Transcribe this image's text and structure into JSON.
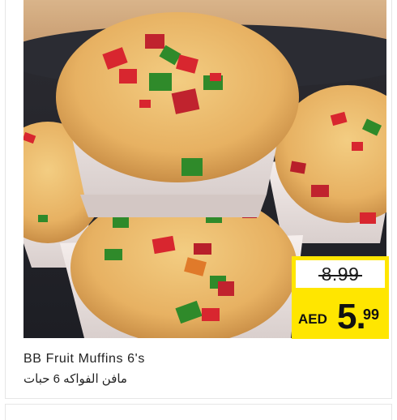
{
  "product": {
    "title_en": "BB Fruit Muffins 6's",
    "title_ar": "مافن الفواكه 6 حبات",
    "image_name": "fruit-muffins-photo"
  },
  "price": {
    "old": "8.99",
    "currency": "AED",
    "new_int": "5.",
    "new_dec": "99"
  },
  "colors": {
    "price_box": "#ffe600",
    "muffin_crust": "#e9b96a",
    "paper_case": "#efe7e4",
    "cherry_red": "#d8262f",
    "cherry_green": "#2f8a2a"
  }
}
